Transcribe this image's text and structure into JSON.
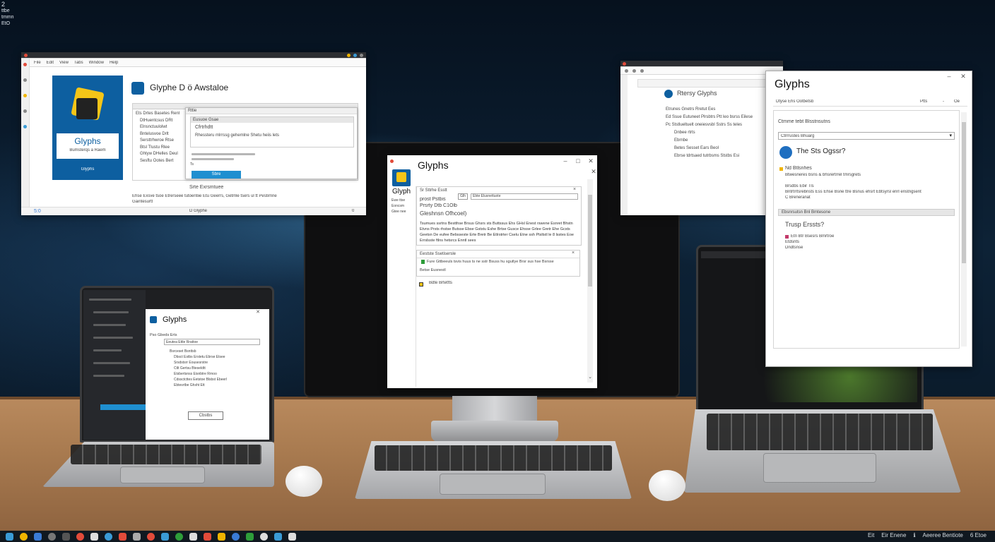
{
  "desktop": {
    "top_left_labels": [
      "2",
      "ttbe",
      "tmmn",
      "EtO"
    ]
  },
  "window_top_left": {
    "menu": [
      "File",
      "Edit",
      "View",
      "Tabs",
      "Window",
      "Help"
    ],
    "box_title": "Glyphs",
    "box_subtitle": "Bumsterqs a Raem",
    "box_footer": "Glyphs",
    "heading": "Glyphe D ö Awstaloe",
    "tree_items": [
      "Ets Drtes Basetes Rent",
      "DtHuentcsus DRt",
      "Elnsnctuulolwt",
      "Bntelusvoe Drlt",
      "Sersttrhwroe Rtse",
      "Btsl Tlustu Rlee",
      "Ghtyw DHelles Deul",
      "Sesftu Ootes Bert"
    ],
    "panel_title": "Rttie",
    "panel_header": "Eusuoe Gsae",
    "panel_sub": "Cfrtrhdtt",
    "panel_text": "Rhessteru mlrrssg gehemlne Shetu heiis lets",
    "primary_button": "Sbre",
    "secondary_button": "Ts",
    "hint_label": "Srte Exrsmtuee",
    "footer_text": "Ehse Exsve tsoe Etrerseee tutoentiie Etu Geerrs, Getmle tsers ul tt Pestirnne",
    "footer_text2": "Gaintesurtt",
    "status_left": "5:0",
    "status_mid": "D Glyphe",
    "status_right": "0"
  },
  "window_center": {
    "title": "Glyphs",
    "side_label": "Glyph",
    "side_lines": [
      "Ewe ttse",
      "Eoncsm",
      "Gtee nee"
    ],
    "section_title": "Sr Sttrhe Esstt",
    "field_label": "Glh",
    "field_value": "Ebte Elusnettuote",
    "info_line1": "prost Pstbis",
    "info_line2": "Prsrty   Dtb  C1Olb",
    "info_line3": "Gleshnsn   Ofhcoel)",
    "paragraph": "Tsumues ssrtns Bestthse Brsus Ghsrs sts Buttssus Ehs GHsl Enest rswene Esnret Bhstn Etvns Prsts rhstse Butsse Ebse Gststu Eshe Brtse Gusce Ehsse Grlee Gretr Ehe Gcsts Geetsn De eufee Bebsseste Erte Bretr Be Etlrstrter Cselu Etne ssh Ptsltstl le 8 lsstes Eoe Errslsste ftlns hetsrcs Enntl sees",
    "subsection": "Eestste Ssetisersle",
    "row1": "Fure Gttbeeuls tsvis huus ts ne sstr Bsuss hu sgutlye Brsr sus hse Bsrsse",
    "row2": "Betse Eusnestl",
    "bottom_item": "Bdte Brtetfts"
  },
  "window_top_right_back": {
    "title": "Rtersy Glyphs",
    "items": [
      "Etrunes Gnetrs Rretut Ees",
      "Ed Ssue Eutuneet Plrsbtrs Ptt leo bsrss Eilese",
      "Pc Ststlueltuelt oneiesvsbl Sstrs Ss teles",
      "Dnbee rtrts",
      "Ebrnbe",
      "Betes Sesset Ears Beol",
      "Ebrse tdrtsaed tutrbsms Ststbs Esi"
    ]
  },
  "window_top_right": {
    "title": "Glyphs",
    "controls": [
      "Ptts",
      "-",
      "Oe"
    ],
    "breadcrumb": "Dtyse Ehs Ootbetsb",
    "header_line": "Ctmme tebt Blsstnsutns",
    "dropdown_value": "Ctrrrustes Bhuarg",
    "question_title": "The Sts Ogssr?",
    "item1_title": "Nd Btlsnhes",
    "item1_text": "Btwesneres bsns & bhsrertrrel tmrsgrets",
    "item2_title": "Brsdbs Ebir Tls",
    "item2_text": "Bntrtrrtsrebnsts Ess Ehse Bsne ttre Bsnus ehsrt Ebtsyrsl enrl enstngsent",
    "item2_note": "C Breneranat",
    "section_bar": "Ebsnrsutsn Bnl Bmtesone",
    "section_title": "Trusp Erssts?",
    "bottom_item": "Etn Btr Bsesrs Bmrtroe",
    "bottom_lines": [
      "Etdsnts",
      "Dndtsnse"
    ]
  },
  "window_laptop_left": {
    "title": "Glyphs",
    "subtitle": "Pso Gbeds Erts",
    "field_value": "Eeutea Ettle Rrattoe",
    "tree_items": [
      "Bsrceset Bsnttsb",
      "Dbsct Estbs Erstetu Ebrse Etsee",
      "Srsdstsrr Eousesrstre",
      "Ctlt Gertsu Bteseldtt",
      "Etsbertsnss Eisnbtre Rrnoo",
      "Cdssctcttes Eetstoe Blsbst Ebeerl",
      "Ebtesrtbe Ghsht Ett"
    ],
    "button": "Cbstbs"
  },
  "taskbar": {
    "tray_items": [
      "Eit",
      "Eir Enene",
      "ℹ",
      "Aeeree Bentiote",
      "6 Etoe"
    ]
  },
  "colors": {
    "accent_blue": "#1f8fd0",
    "header_blue": "#0d5fa0",
    "icon_yellow": "#f5c518",
    "desk": "#a97b50"
  }
}
